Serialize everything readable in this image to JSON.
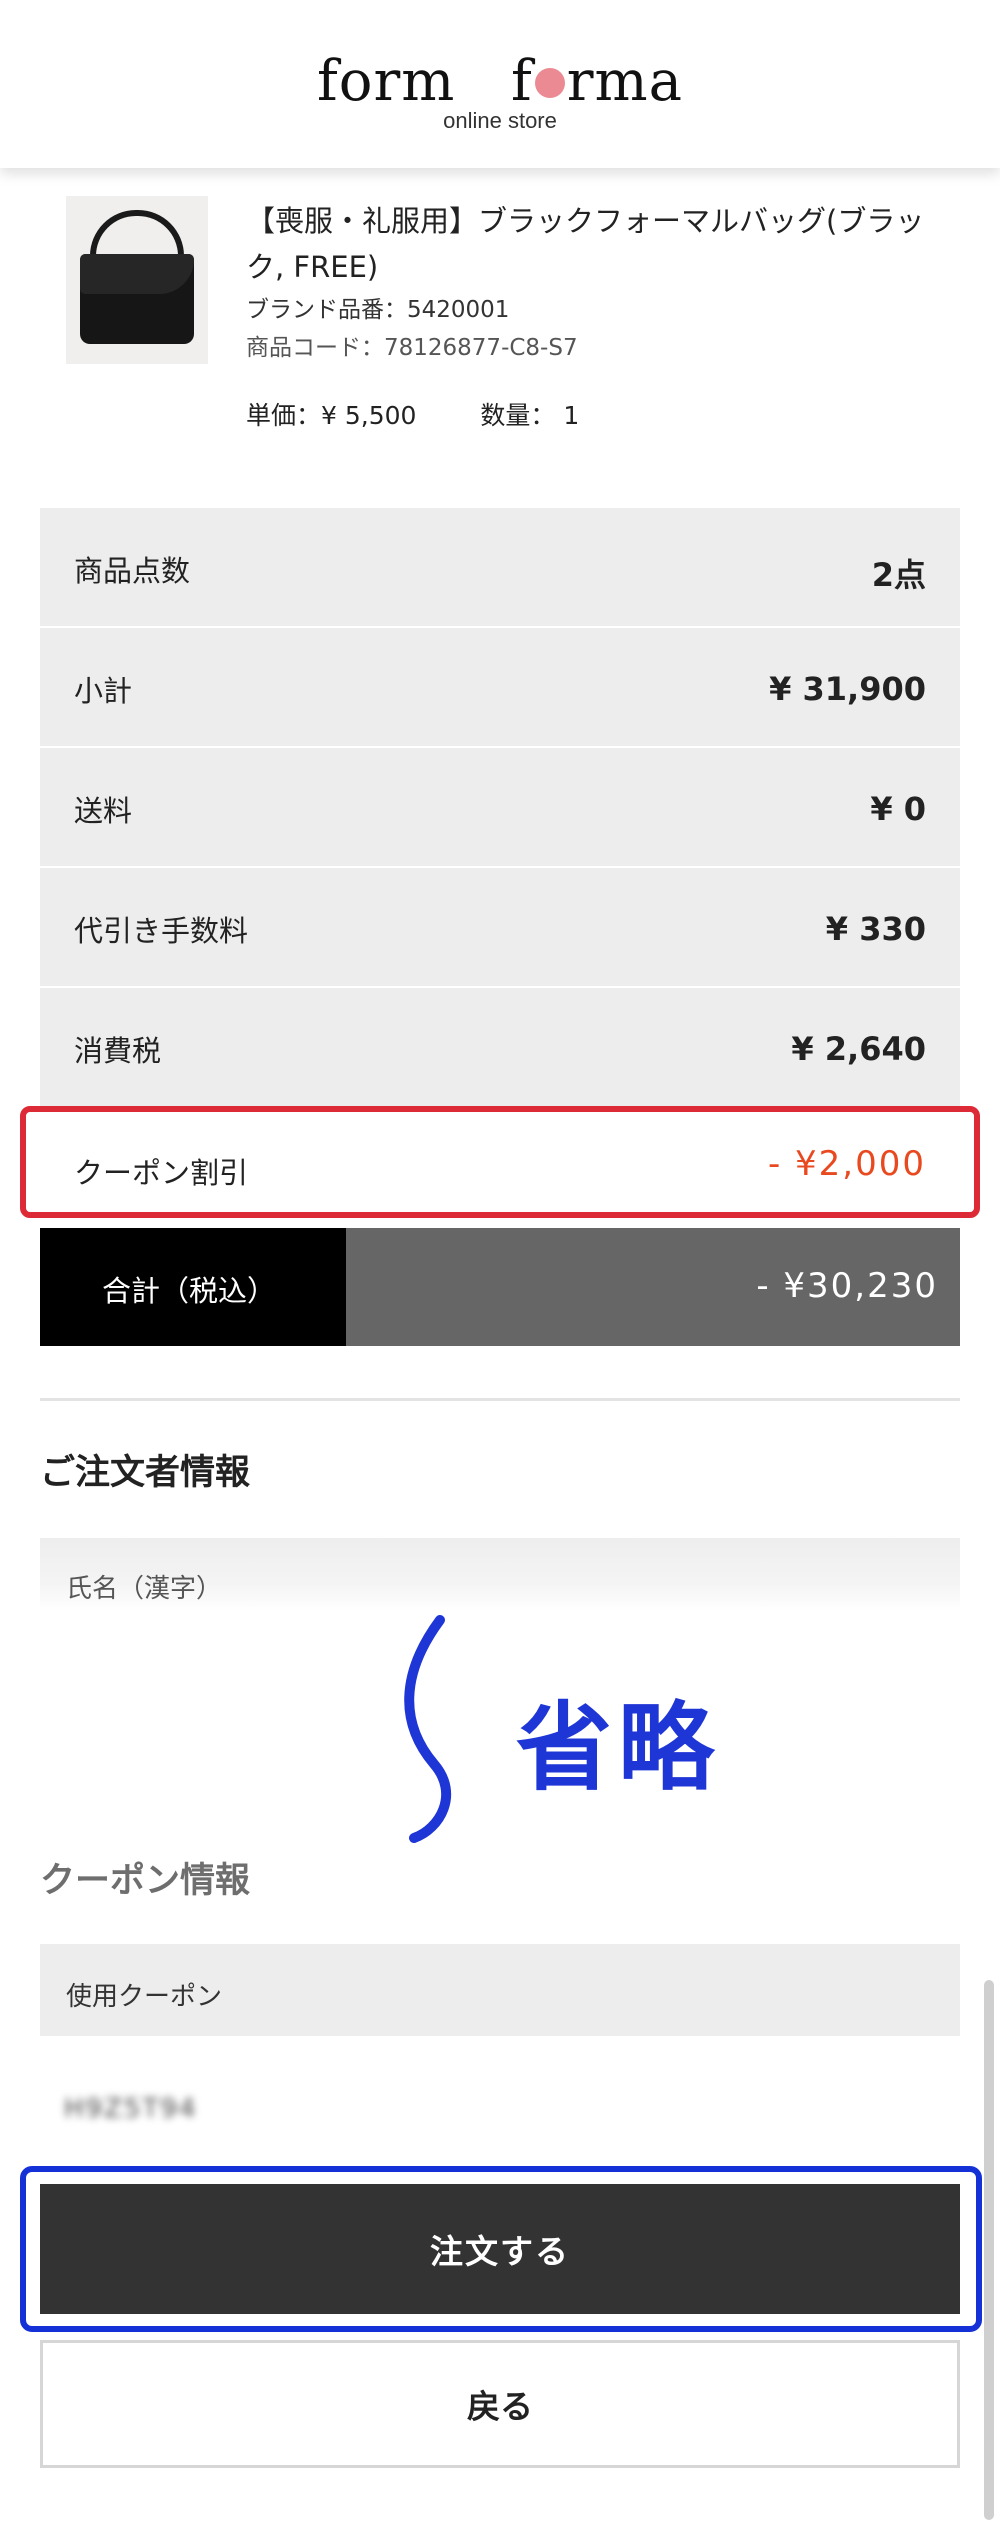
{
  "header": {
    "logo_left": "form",
    "logo_right_pre": "f",
    "logo_right_post": "rma",
    "logo_sub": "online store"
  },
  "product": {
    "name": "【喪服・礼服用】ブラックフォーマルバッグ(ブラック, FREE)",
    "brand_code": "ブランド品番：5420001",
    "item_code": "商品コード：78126877-C8-S7",
    "unit_price": "単価：¥ 5,500",
    "quantity": "数量： 1"
  },
  "summary": {
    "rows": [
      {
        "label": "商品点数",
        "value": "2点"
      },
      {
        "label": "小計",
        "value": "¥ 31,900"
      },
      {
        "label": "送料",
        "value": "¥ 0"
      },
      {
        "label": "代引き手数料",
        "value": "¥ 330"
      },
      {
        "label": "消費税",
        "value": "¥ 2,640"
      }
    ],
    "coupon": {
      "label": "クーポン割引",
      "value": "- ¥2,000"
    },
    "total": {
      "label": "合計（税込）",
      "value": "- ¥30,230"
    }
  },
  "orderer": {
    "title": "ご注文者情報",
    "name_field_label": "氏名（漢字）"
  },
  "omit_label": "省略",
  "coupon_info": {
    "title": "クーポン情報",
    "use_label": "使用クーポン",
    "code": "H9Z5T94"
  },
  "actions": {
    "order": "注文する",
    "back": "戻る"
  },
  "colors": {
    "coupon_highlight": "#dc2a37",
    "order_highlight": "#1431d8",
    "discount_text": "#e8491f",
    "logo_dot": "#ec8a93"
  }
}
